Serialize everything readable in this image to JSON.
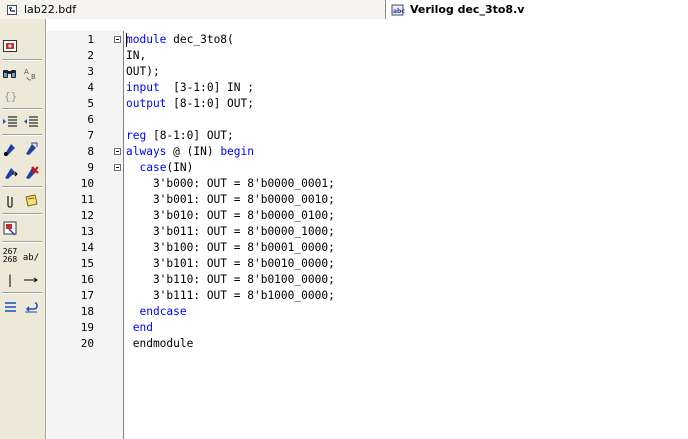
{
  "tabs": [
    {
      "label": "lab22.bdf",
      "icon": "bdf-file-icon",
      "active": false
    },
    {
      "label": "Verilog dec_3to8.v",
      "icon": "verilog-file-icon",
      "active": true
    }
  ],
  "toolbar": {
    "items": [
      {
        "name": "insert-block-icon"
      },
      {
        "name": "find-icon"
      },
      {
        "name": "find-replace-icon"
      },
      {
        "name": "braces-icon"
      },
      {
        "name": "indent-icon"
      },
      {
        "name": "unindent-icon"
      },
      {
        "name": "bookmark-icon"
      },
      {
        "name": "clear-bookmark-icon"
      },
      {
        "name": "goto-bookmark-icon"
      },
      {
        "name": "delete-bookmark-icon"
      },
      {
        "name": "attach-icon"
      },
      {
        "name": "note-icon"
      },
      {
        "name": "insert-template-icon"
      },
      {
        "name": "line-numbers-icon",
        "text_top": "267",
        "text_bottom": "268"
      },
      {
        "name": "ab-icon",
        "text": "ab/"
      },
      {
        "name": "vertical-bar-icon",
        "text": "|"
      },
      {
        "name": "arrow-right-icon"
      },
      {
        "name": "list-icon"
      },
      {
        "name": "undo-line-icon"
      }
    ]
  },
  "editor": {
    "lines": [
      {
        "num": "1",
        "fold": true,
        "segments": [
          {
            "t": "module",
            "kw": true
          },
          {
            "t": " dec_3to8(",
            "kw": false
          }
        ]
      },
      {
        "num": "2",
        "fold": false,
        "segments": [
          {
            "t": "IN,",
            "kw": false
          }
        ]
      },
      {
        "num": "3",
        "fold": false,
        "segments": [
          {
            "t": "OUT);",
            "kw": false
          }
        ]
      },
      {
        "num": "4",
        "fold": false,
        "segments": [
          {
            "t": "input",
            "kw": true
          },
          {
            "t": "  [3-1:0] IN ;",
            "kw": false
          }
        ]
      },
      {
        "num": "5",
        "fold": false,
        "segments": [
          {
            "t": "output",
            "kw": true
          },
          {
            "t": " [8-1:0] OUT;",
            "kw": false
          }
        ]
      },
      {
        "num": "6",
        "fold": false,
        "segments": []
      },
      {
        "num": "7",
        "fold": false,
        "segments": [
          {
            "t": "reg",
            "kw": true
          },
          {
            "t": " [8-1:0] OUT;",
            "kw": false
          }
        ]
      },
      {
        "num": "8",
        "fold": true,
        "segments": [
          {
            "t": "always",
            "kw": true
          },
          {
            "t": " @ (IN) ",
            "kw": false
          },
          {
            "t": "begin",
            "kw": true
          }
        ]
      },
      {
        "num": "9",
        "fold": true,
        "segments": [
          {
            "t": "  ",
            "kw": false
          },
          {
            "t": "case",
            "kw": true
          },
          {
            "t": "(IN)",
            "kw": false
          }
        ]
      },
      {
        "num": "10",
        "fold": false,
        "segments": [
          {
            "t": "    3'b000: OUT = 8'b0000_0001;",
            "kw": false
          }
        ]
      },
      {
        "num": "11",
        "fold": false,
        "segments": [
          {
            "t": "    3'b001: OUT = 8'b0000_0010;",
            "kw": false
          }
        ]
      },
      {
        "num": "12",
        "fold": false,
        "segments": [
          {
            "t": "    3'b010: OUT = 8'b0000_0100;",
            "kw": false
          }
        ]
      },
      {
        "num": "13",
        "fold": false,
        "segments": [
          {
            "t": "    3'b011: OUT = 8'b0000_1000;",
            "kw": false
          }
        ]
      },
      {
        "num": "14",
        "fold": false,
        "segments": [
          {
            "t": "    3'b100: OUT = 8'b0001_0000;",
            "kw": false
          }
        ]
      },
      {
        "num": "15",
        "fold": false,
        "segments": [
          {
            "t": "    3'b101: OUT = 8'b0010_0000;",
            "kw": false
          }
        ]
      },
      {
        "num": "16",
        "fold": false,
        "segments": [
          {
            "t": "    3'b110: OUT = 8'b0100_0000;",
            "kw": false
          }
        ]
      },
      {
        "num": "17",
        "fold": false,
        "segments": [
          {
            "t": "    3'b111: OUT = 8'b1000_0000;",
            "kw": false
          }
        ]
      },
      {
        "num": "18",
        "fold": false,
        "segments": [
          {
            "t": "  ",
            "kw": false
          },
          {
            "t": "endcase",
            "kw": true
          }
        ]
      },
      {
        "num": "19",
        "fold": false,
        "segments": [
          {
            "t": " ",
            "kw": false
          },
          {
            "t": "end",
            "kw": true
          }
        ]
      },
      {
        "num": "20",
        "fold": false,
        "segments": [
          {
            "t": " endmodule",
            "kw": false
          }
        ]
      }
    ]
  },
  "colors": {
    "keyword": "#0000ff",
    "text": "#000000",
    "gutter": "#f4f4f4",
    "chrome": "#ece9d8"
  }
}
